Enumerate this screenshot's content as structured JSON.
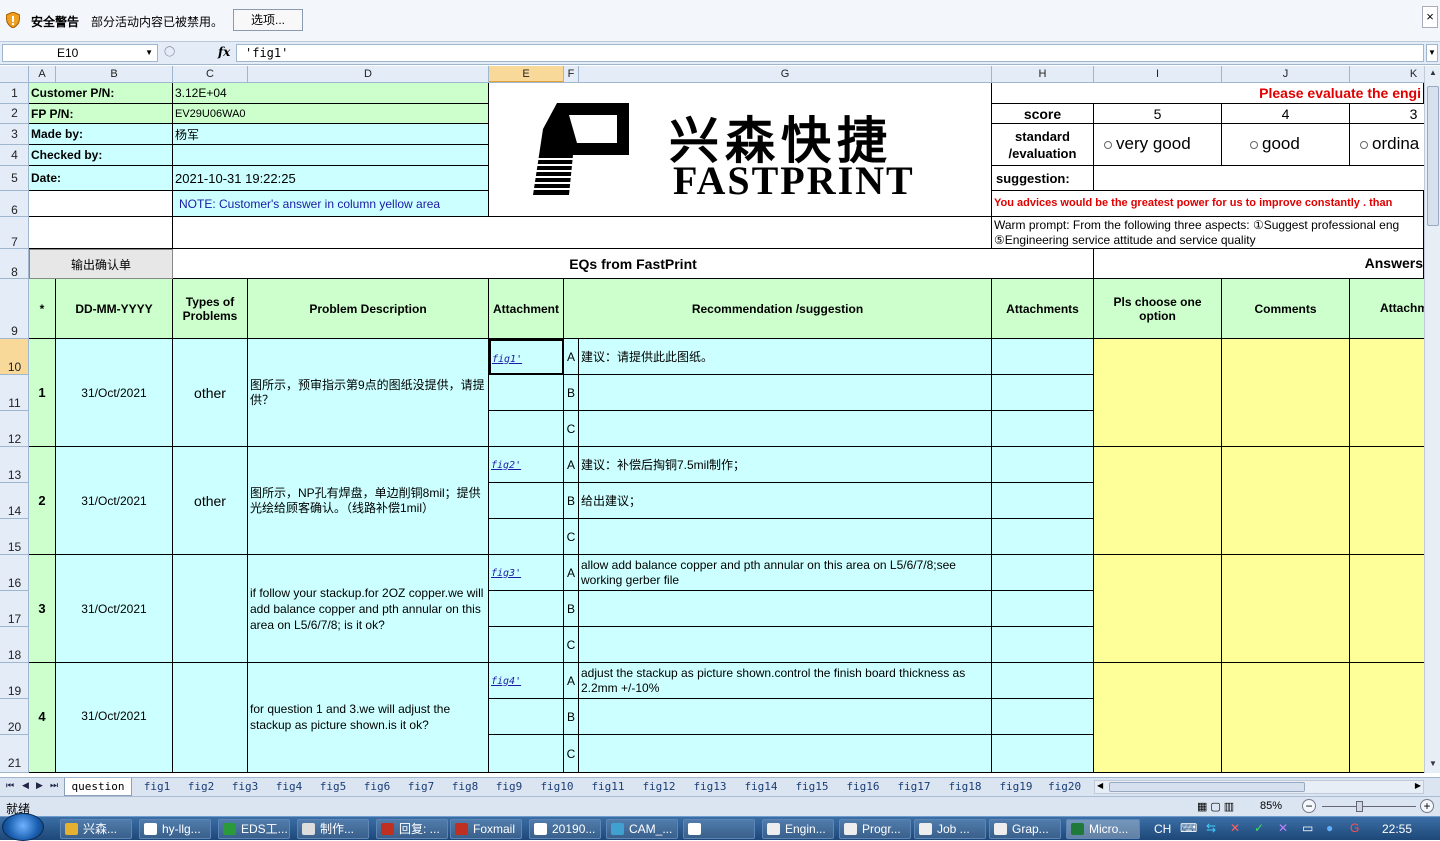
{
  "security_bar": {
    "title": "安全警告",
    "message": "部分活动内容已被禁用。",
    "options_button": "选项...",
    "close": "×"
  },
  "formula_bar": {
    "name_box": "E10",
    "fx": "fx",
    "formula": "'fig1'"
  },
  "columns": [
    "A",
    "B",
    "C",
    "D",
    "E",
    "F",
    "G",
    "H",
    "I",
    "J",
    "K"
  ],
  "rows": [
    "1",
    "2",
    "3",
    "4",
    "5",
    "6",
    "7",
    "8",
    "9",
    "10",
    "11",
    "12",
    "13",
    "14",
    "15",
    "16",
    "17",
    "18",
    "19",
    "20",
    "21"
  ],
  "header_info": {
    "customer_pn_label": "Customer P/N:",
    "customer_pn": "3.12E+04",
    "fp_pn_label": "FP P/N:",
    "fp_pn": "EV29U06WA0",
    "made_by_label": "Made by:",
    "made_by": "杨军",
    "checked_by_label": "Checked by:",
    "checked_by": "",
    "date_label": "Date:",
    "date": "2021-10-31 19:22:25",
    "note": "NOTE: Customer's  answer in column yellow area"
  },
  "logo": {
    "chinese": "兴森快捷",
    "english": "FASTPRINT"
  },
  "evaluation": {
    "please_evaluate": "Please evaluate the engi",
    "score_label": "score",
    "score_5": "5",
    "score_4": "4",
    "score_3": "3",
    "standard_label": "standard\n/evaluation",
    "opt_very_good": "very good",
    "opt_good": "good",
    "opt_ordinary": "ordina",
    "suggestion_label": "suggestion:",
    "advice": "You advices would be the greatest power for us to improve constantly .   than",
    "warm_prompt_1": "Warm prompt: From the following three aspects: ①Suggest professional eng",
    "warm_prompt_2": "⑤Engineering service attitude and service quality"
  },
  "toolbar": {
    "output_button": "输出确认单",
    "eqs_title": "EQs from FastPrint",
    "answers_title": "Answers"
  },
  "table_headers": {
    "star": "*",
    "date": "DD-MM-YYYY",
    "types": "Types of\nProblems",
    "problem": "Problem Description",
    "attachment": "Attachment",
    "recommendation": "Recommendation /suggestion",
    "attachments": "Attachments",
    "choose": "Pls choose one\noption",
    "comments": "Comments",
    "attachm": "Attachm"
  },
  "eqs": [
    {
      "no": "1",
      "date": "31/Oct/2021",
      "type": "other",
      "problem": "图所示，预审指示第9点的图纸没提供，请提供？",
      "attachment": "fig1'",
      "options": [
        {
          "letter": "A",
          "text": "建议：请提供此此图纸。"
        },
        {
          "letter": "B",
          "text": ""
        },
        {
          "letter": "C",
          "text": ""
        }
      ]
    },
    {
      "no": "2",
      "date": "31/Oct/2021",
      "type": "other",
      "problem": "图所示，NP孔有焊盘，单边削铜8mil；提供光绘给顾客确认。（线路补偿1mil）",
      "attachment": "fig2'",
      "options": [
        {
          "letter": "A",
          "text": "建议：补偿后掏铜7.5mil制作；"
        },
        {
          "letter": "B",
          "text": "给出建议；"
        },
        {
          "letter": "C",
          "text": ""
        }
      ]
    },
    {
      "no": "3",
      "date": "31/Oct/2021",
      "type": "",
      "problem": "if follow your stackup.for 2OZ copper.we will add balance  copper and pth annular on this area on L5/6/7/8; is it ok?",
      "attachment": "fig3'",
      "options": [
        {
          "letter": "A",
          "text": "allow add balance  copper and pth annular on this area on L5/6/7/8;see working gerber file"
        },
        {
          "letter": "B",
          "text": ""
        },
        {
          "letter": "C",
          "text": ""
        }
      ]
    },
    {
      "no": "4",
      "date": "31/Oct/2021",
      "type": "",
      "problem": "for question 1 and 3.we will adjust the stackup as picture shown.is it ok?",
      "attachment": "fig4'",
      "options": [
        {
          "letter": "A",
          "text": "adjust the stackup as picture shown.control the finish board thickness as 2.2mm +/-10%"
        },
        {
          "letter": "B",
          "text": ""
        },
        {
          "letter": "C",
          "text": ""
        }
      ]
    }
  ],
  "sheet_tabs": [
    "question",
    "fig1",
    "fig2",
    "fig3",
    "fig4",
    "fig5",
    "fig6",
    "fig7",
    "fig8",
    "fig9",
    "fig10",
    "fig11",
    "fig12",
    "fig13",
    "fig14",
    "fig15",
    "fig16",
    "fig17",
    "fig18",
    "fig19",
    "fig20"
  ],
  "status": {
    "ready": "就绪",
    "zoom": "85%",
    "zoom_minus": "−",
    "zoom_plus": "+"
  },
  "taskbar": {
    "items": [
      "兴森...",
      "hy-llg...",
      "EDS工...",
      "制作...",
      "回复: ...",
      "Foxmail",
      "20190...",
      "CAM_...",
      "",
      "Engin...",
      "Progr...",
      "Job ...",
      "Grap...",
      "Micro..."
    ],
    "lang": "CH",
    "time": "22:55"
  },
  "colors": {
    "green": "#ccffcc",
    "cyan": "#ccffff",
    "yellow": "#ffff99",
    "red_text": "#e00000",
    "blue_text": "#1a1aa6"
  }
}
